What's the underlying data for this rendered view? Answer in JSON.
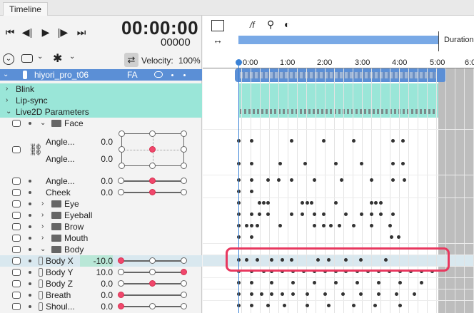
{
  "tab": "Timeline",
  "timecode": "00:00:00",
  "frames": "00000",
  "velocity_label": "Velocity:",
  "velocity_value": "100%",
  "model_row": {
    "name": "hiyori_pro_t06",
    "badge": "FA"
  },
  "groups": [
    "Blink",
    "Lip-sync",
    "Live2D Parameters"
  ],
  "face_folder": "Face",
  "params_face": [
    {
      "label": "Angle...",
      "value": "0.0"
    },
    {
      "label": "Angle...",
      "value": "0.0"
    }
  ],
  "params_face2": [
    {
      "label": "Angle...",
      "value": "0.0"
    },
    {
      "label": "Cheek",
      "value": "0.0"
    }
  ],
  "folders": [
    "Eye",
    "Eyeball",
    "Brow",
    "Mouth",
    "Body"
  ],
  "body_params": [
    {
      "label": "Body X",
      "value": "-10.0"
    },
    {
      "label": "Body Y",
      "value": "10.0"
    },
    {
      "label": "Body Z",
      "value": "0.0"
    },
    {
      "label": "Breath",
      "value": "0.0"
    },
    {
      "label": "Shoul...",
      "value": "0.0"
    }
  ],
  "ruler": [
    "0:00",
    "1:00",
    "2:00",
    "3:00",
    "4:00",
    "5:00",
    "6:0"
  ],
  "duration_label": "Duration",
  "timeline_tools": [
    "/f"
  ],
  "accent_color": "#5b8fd6",
  "highlight_color": "#e8385f"
}
